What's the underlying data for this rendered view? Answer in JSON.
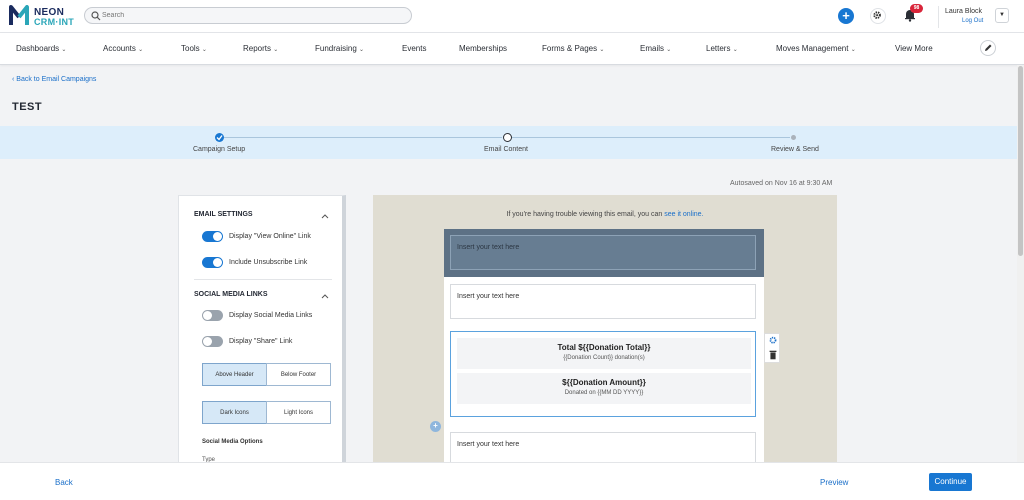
{
  "brand": {
    "line1": "NEON",
    "line2": "CRM·INT"
  },
  "search": {
    "placeholder": "Search"
  },
  "notifications": {
    "count": "98"
  },
  "user": {
    "name": "Laura Block",
    "logout": "Log Out"
  },
  "nav": {
    "items": [
      {
        "label": "Dashboards",
        "chevron": "⌄"
      },
      {
        "label": "Accounts",
        "chevron": "⌄"
      },
      {
        "label": "Tools",
        "chevron": "⌄"
      },
      {
        "label": "Reports",
        "chevron": "⌄"
      },
      {
        "label": "Fundraising",
        "chevron": "⌄"
      },
      {
        "label": "Events",
        "chevron": ""
      },
      {
        "label": "Memberships",
        "chevron": ""
      },
      {
        "label": "Forms & Pages",
        "chevron": "⌄"
      },
      {
        "label": "Emails",
        "chevron": "⌄"
      },
      {
        "label": "Letters",
        "chevron": "⌄"
      },
      {
        "label": "Moves Management",
        "chevron": "⌄"
      },
      {
        "label": "View More",
        "chevron": ""
      }
    ]
  },
  "page": {
    "back_link": "Back to Email Campaigns",
    "title": "TEST"
  },
  "steps": [
    {
      "label": "Campaign Setup",
      "state": "complete"
    },
    {
      "label": "Email Content",
      "state": "current"
    },
    {
      "label": "Review & Send",
      "state": "upcoming"
    }
  ],
  "autosaved": "Autosaved on Nov 16 at 9:30 AM",
  "sidebar": {
    "email_settings": {
      "heading": "EMAIL SETTINGS",
      "toggles": [
        {
          "label": "Display \"View Online\" Link",
          "on": true
        },
        {
          "label": "Include Unsubscribe Link",
          "on": true
        }
      ]
    },
    "social": {
      "heading": "SOCIAL MEDIA LINKS",
      "toggles": [
        {
          "label": "Display Social Media Links",
          "on": false
        },
        {
          "label": "Display \"Share\" Link",
          "on": false
        }
      ],
      "position_options": [
        "Above Header",
        "Below Footer"
      ],
      "position_selected": "Above Header",
      "icon_options": [
        "Dark Icons",
        "Light Icons"
      ],
      "icon_selected": "Dark Icons",
      "options_heading": "Social Media Options",
      "type_label": "Type"
    }
  },
  "email": {
    "trouble_text": "If you're having trouble viewing this email, you can",
    "trouble_link": "see it online.",
    "header_placeholder": "Insert your text here",
    "text_block_1": "Insert your text here",
    "donation_total": "Total ${{Donation Total}}",
    "donation_count": "{{Donation Count}} donation(s)",
    "donation_amount": "${{Donation Amount}}",
    "donated_on": "Donated on {{MM DD YYYY}}",
    "text_block_2": "Insert your text here"
  },
  "footer": {
    "back": "Back",
    "preview": "Preview",
    "continue": "Continue"
  },
  "colors": {
    "primary": "#1877d2",
    "stepper_bg": "#ddeefb",
    "email_header": "#5d7185",
    "canvas_bg": "#e0ddd2",
    "badge": "#d9253a"
  }
}
